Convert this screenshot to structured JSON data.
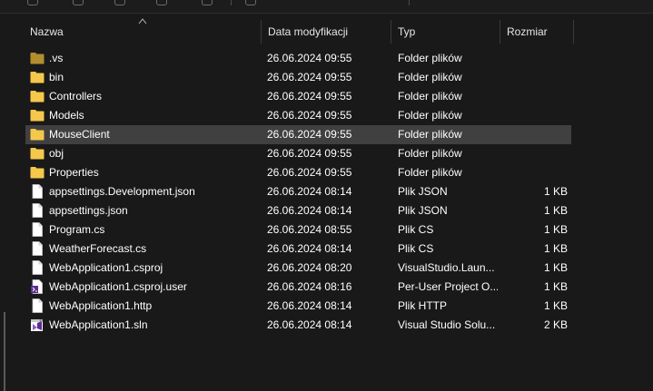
{
  "columns": {
    "name": "Nazwa",
    "date": "Data modyfikacji",
    "type": "Typ",
    "size": "Rozmiar"
  },
  "files": [
    {
      "name": ".vs",
      "date": "26.06.2024 09:55",
      "type": "Folder plików",
      "size": "",
      "icon": "folder-dim-icon"
    },
    {
      "name": "bin",
      "date": "26.06.2024 09:55",
      "type": "Folder plików",
      "size": "",
      "icon": "folder-icon"
    },
    {
      "name": "Controllers",
      "date": "26.06.2024 09:55",
      "type": "Folder plików",
      "size": "",
      "icon": "folder-icon"
    },
    {
      "name": "Models",
      "date": "26.06.2024 09:55",
      "type": "Folder plików",
      "size": "",
      "icon": "folder-icon"
    },
    {
      "name": "MouseClient",
      "date": "26.06.2024 09:55",
      "type": "Folder plików",
      "size": "",
      "icon": "folder-icon"
    },
    {
      "name": "obj",
      "date": "26.06.2024 09:55",
      "type": "Folder plików",
      "size": "",
      "icon": "folder-icon"
    },
    {
      "name": "Properties",
      "date": "26.06.2024 09:55",
      "type": "Folder plików",
      "size": "",
      "icon": "folder-icon"
    },
    {
      "name": "appsettings.Development.json",
      "date": "26.06.2024 08:14",
      "type": "Plik JSON",
      "size": "1 KB",
      "icon": "file-icon"
    },
    {
      "name": "appsettings.json",
      "date": "26.06.2024 08:14",
      "type": "Plik JSON",
      "size": "1 KB",
      "icon": "file-icon"
    },
    {
      "name": "Program.cs",
      "date": "26.06.2024 08:55",
      "type": "Plik CS",
      "size": "1 KB",
      "icon": "file-icon"
    },
    {
      "name": "WeatherForecast.cs",
      "date": "26.06.2024 08:14",
      "type": "Plik CS",
      "size": "1 KB",
      "icon": "file-icon"
    },
    {
      "name": "WebApplication1.csproj",
      "date": "26.06.2024 08:20",
      "type": "VisualStudio.Laun...",
      "size": "1 KB",
      "icon": "file-icon"
    },
    {
      "name": "WebApplication1.csproj.user",
      "date": "26.06.2024 08:16",
      "type": "Per-User Project O...",
      "size": "1 KB",
      "icon": "file-user-icon"
    },
    {
      "name": "WebApplication1.http",
      "date": "26.06.2024 08:14",
      "type": "Plik HTTP",
      "size": "1 KB",
      "icon": "file-icon"
    },
    {
      "name": "WebApplication1.sln",
      "date": "26.06.2024 08:14",
      "type": "Visual Studio Solu...",
      "size": "2 KB",
      "icon": "vs-solution-icon"
    }
  ],
  "selected_index": 4,
  "colors": {
    "folder": "#f5c84c",
    "folder_dim": "#b38e2f",
    "selection": "#404040",
    "background": "#191919"
  }
}
